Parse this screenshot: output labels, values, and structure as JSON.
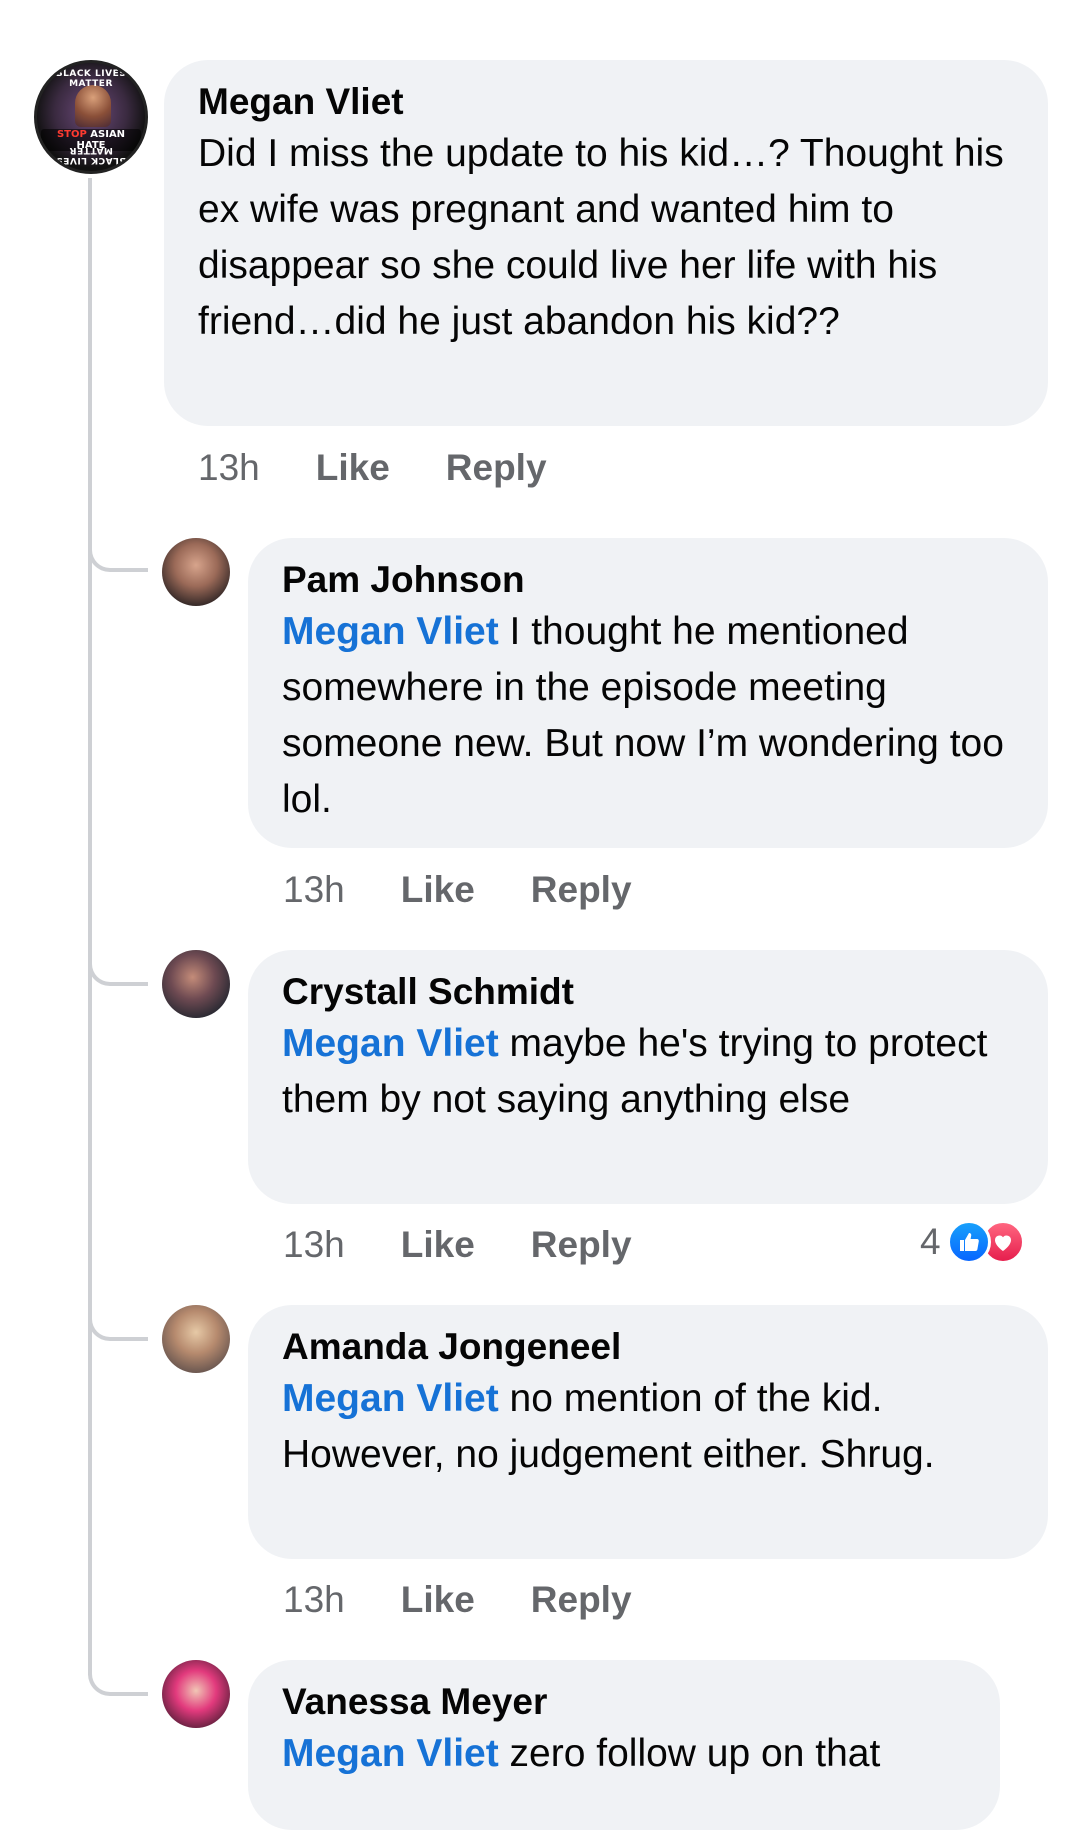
{
  "colors": {
    "bubble": "#f0f2f5",
    "mention": "#1672d6",
    "meta": "#65676b",
    "thread_line": "#ced0d4",
    "like": "#0866ff",
    "love": "#e61e4d"
  },
  "main_comment": {
    "author": "Megan Vliet",
    "text": "Did I miss the update to his kid…? Thought his ex wife was pregnant and wanted him to disappear so she could live her life with his friend…did he just abandon his kid??",
    "time": "13h",
    "like_label": "Like",
    "reply_label": "Reply",
    "avatar": {
      "ring_top": "BLACK LIVES MATTER",
      "center_red": "STOP",
      "center_white": " ASIAN HATE",
      "ring_bottom": "BLACK LIVES MATTER"
    }
  },
  "replies": [
    {
      "author": "Pam Johnson",
      "mention": "Megan Vliet",
      "text": " I thought he mentioned somewhere in the episode meeting someone new. But now I’m wondering too lol.",
      "time": "13h",
      "like_label": "Like",
      "reply_label": "Reply"
    },
    {
      "author": "Crystall Schmidt",
      "mention": "Megan Vliet",
      "text": " maybe he's trying to protect them by not saying anything else",
      "time": "13h",
      "like_label": "Like",
      "reply_label": "Reply",
      "reaction_count": "4",
      "reaction_icons": [
        "like-icon",
        "love-icon"
      ]
    },
    {
      "author": "Amanda Jongeneel",
      "mention": "Megan Vliet",
      "text": " no mention of the kid. However, no judgement either. Shrug.",
      "time": "13h",
      "like_label": "Like",
      "reply_label": "Reply"
    },
    {
      "author": "Vanessa Meyer",
      "mention": "Megan Vliet",
      "text": " zero follow up on that"
    }
  ]
}
